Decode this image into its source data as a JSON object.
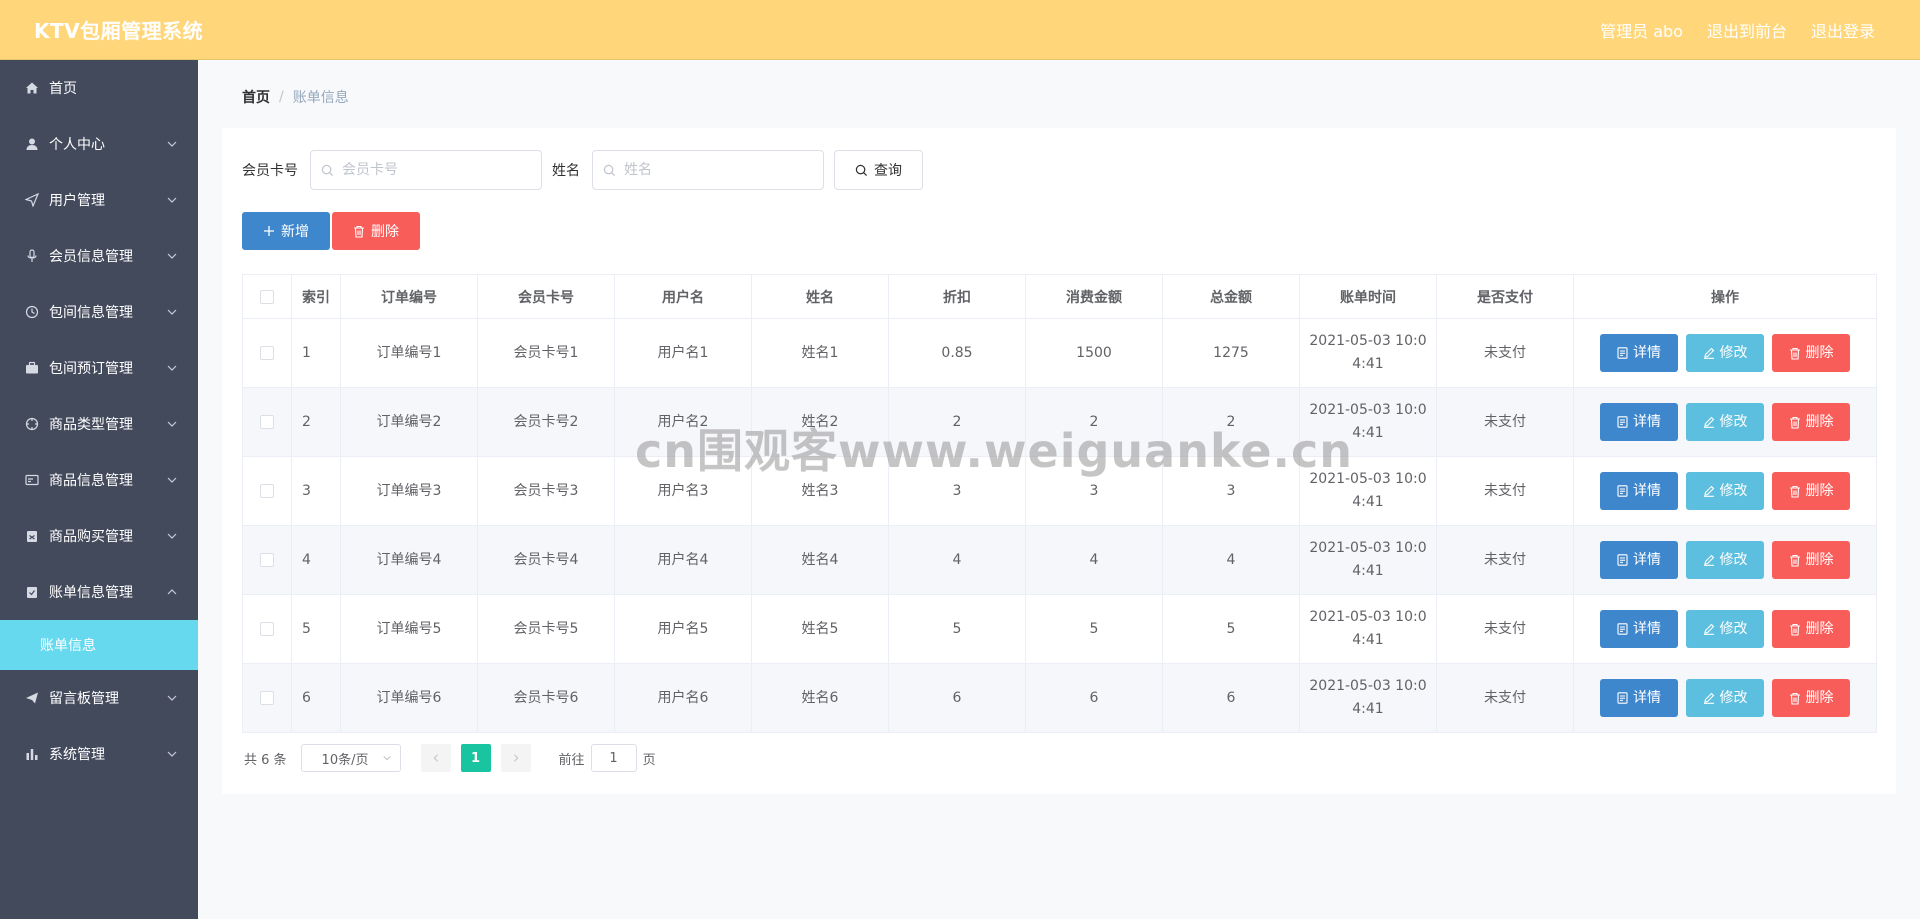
{
  "header": {
    "title": "KTV包厢管理系统",
    "admin_label": "管理员 abo",
    "back_to_front": "退出到前台",
    "logout": "退出登录"
  },
  "sidebar": {
    "items": [
      {
        "label": "首页",
        "icon": "home-icon"
      },
      {
        "label": "个人中心",
        "icon": "user-icon"
      },
      {
        "label": "用户管理",
        "icon": "send-icon"
      },
      {
        "label": "会员信息管理",
        "icon": "microphone-icon"
      },
      {
        "label": "包间信息管理",
        "icon": "clock-icon"
      },
      {
        "label": "包间预订管理",
        "icon": "briefcase-icon"
      },
      {
        "label": "商品类型管理",
        "icon": "compass-icon"
      },
      {
        "label": "商品信息管理",
        "icon": "card-icon"
      },
      {
        "label": "商品购买管理",
        "icon": "clipboard-icon"
      },
      {
        "label": "账单信息管理",
        "icon": "checklist-icon"
      },
      {
        "label": "留言板管理",
        "icon": "paper-plane-icon"
      },
      {
        "label": "系统管理",
        "icon": "bar-chart-icon"
      }
    ],
    "active_sub": "账单信息"
  },
  "breadcrumb": {
    "home": "首页",
    "separator": "/",
    "current": "账单信息"
  },
  "search": {
    "card_label": "会员卡号",
    "card_placeholder": "会员卡号",
    "name_label": "姓名",
    "name_placeholder": "姓名",
    "query_label": "查询"
  },
  "actions": {
    "add_label": "新增",
    "delete_label": "删除"
  },
  "table": {
    "headers": [
      "索引",
      "订单编号",
      "会员卡号",
      "用户名",
      "姓名",
      "折扣",
      "消费金额",
      "总金额",
      "账单时间",
      "是否支付",
      "操作"
    ],
    "rows": [
      [
        "1",
        "订单编号1",
        "会员卡号1",
        "用户名1",
        "姓名1",
        "0.85",
        "1500",
        "1275",
        "2021-05-03 10:04:41",
        "未支付"
      ],
      [
        "2",
        "订单编号2",
        "会员卡号2",
        "用户名2",
        "姓名2",
        "2",
        "2",
        "2",
        "2021-05-03 10:04:41",
        "未支付"
      ],
      [
        "3",
        "订单编号3",
        "会员卡号3",
        "用户名3",
        "姓名3",
        "3",
        "3",
        "3",
        "2021-05-03 10:04:41",
        "未支付"
      ],
      [
        "4",
        "订单编号4",
        "会员卡号4",
        "用户名4",
        "姓名4",
        "4",
        "4",
        "4",
        "2021-05-03 10:04:41",
        "未支付"
      ],
      [
        "5",
        "订单编号5",
        "会员卡号5",
        "用户名5",
        "姓名5",
        "5",
        "5",
        "5",
        "2021-05-03 10:04:41",
        "未支付"
      ],
      [
        "6",
        "订单编号6",
        "会员卡号6",
        "用户名6",
        "姓名6",
        "6",
        "6",
        "6",
        "2021-05-03 10:04:41",
        "未支付"
      ]
    ],
    "row_buttons": {
      "detail": "详情",
      "edit": "修改",
      "delete": "删除"
    }
  },
  "pagination": {
    "total": "共 6 条",
    "page_size": "10条/页",
    "current_page": "1",
    "goto_label": "前往",
    "goto_value": "1",
    "goto_unit": "页"
  },
  "watermark": "cn围观客www.weiguanke.cn",
  "colors": {
    "header_bg": "#ffd77a",
    "sidebar_bg": "#434a5c",
    "active_sub_bg": "#66d9ef",
    "primary": "#3f87cd",
    "info": "#5cbfdf",
    "danger": "#f95d5a",
    "pager_active": "#19c4a0"
  }
}
